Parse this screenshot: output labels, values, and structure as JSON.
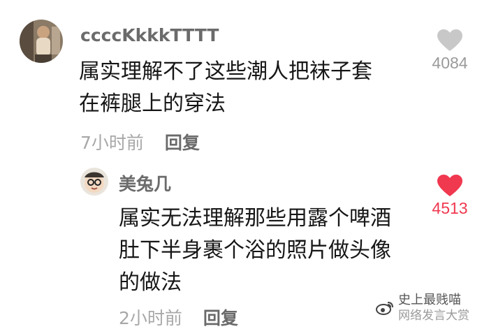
{
  "comments": [
    {
      "username": "ccccKkkkTTTT",
      "lines": [
        "属实理解不了这些潮人把袜子套",
        "在裤腿上的穿法"
      ],
      "time": "7小时前",
      "reply_label": "回复",
      "likes": "4084",
      "liked": false,
      "avatar_icon": "user-photo-avatar"
    },
    {
      "username": "美兔几",
      "lines": [
        "属实无法理解那些用露个啤酒",
        "肚下半身裹个浴的照片做头像",
        "的做法"
      ],
      "time": "2小时前",
      "reply_label": "回复",
      "likes": "4513",
      "liked": true,
      "avatar_icon": "cartoon-face-avatar"
    }
  ],
  "watermark": {
    "line1": "史上最贱喵",
    "line2": "网络发言大赏",
    "icon": "weibo-logo-icon"
  },
  "colors": {
    "like_active": "#f0384f",
    "like_inactive": "#c8c8c8",
    "meta_text": "#a8a8a8"
  }
}
